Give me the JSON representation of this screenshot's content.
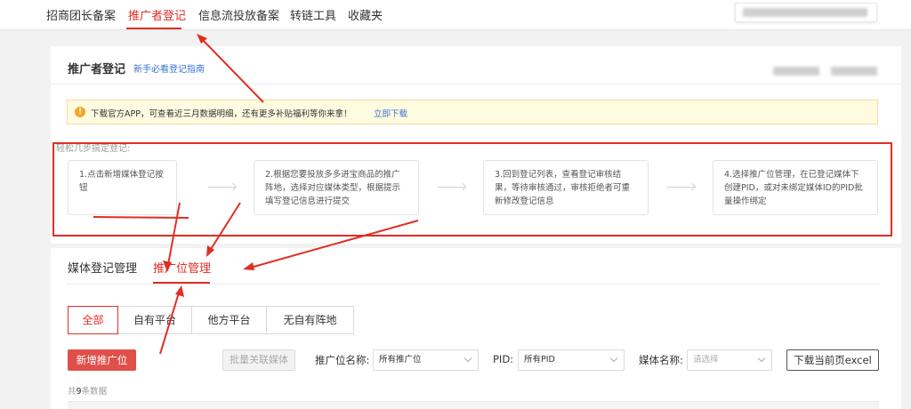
{
  "topnav": {
    "items": [
      "招商团长备案",
      "推广者登记",
      "信息流投放备案",
      "转链工具",
      "收藏夹"
    ],
    "active_index": 1
  },
  "register": {
    "title": "推广者登记",
    "guide_link": "新手必看登记指南",
    "notice": {
      "text": "下载官方APP，可查看近三月数据明细，还有更多补贴福利等你来拿！",
      "link": "立即下载"
    },
    "steps_label": "轻松几步搞定登记:",
    "steps": [
      "1.点击新增媒体登记按钮",
      "2.根据您要投放多多进宝商品的推广阵地，选择对应媒体类型，根据提示填写登记信息进行提交",
      "3.回到登记列表，查看登记审核结果，等待审核通过，审核拒绝者可重新修改登记信息",
      "4.选择推广位管理，在已登记媒体下创建PID，或对未绑定媒体ID的PID批量操作绑定"
    ]
  },
  "management": {
    "tabs": [
      "媒体登记管理",
      "推广位管理"
    ],
    "active_tab": 1,
    "segments": [
      "全部",
      "自有平台",
      "他方平台",
      "无自有阵地"
    ],
    "active_segment": 0,
    "toolbar": {
      "add_button": "新增推广位",
      "batch_button": "批量关联媒体",
      "position_label": "推广位名称:",
      "position_value": "所有推广位",
      "pid_label": "PID:",
      "pid_value": "所有PID",
      "media_label": "媒体名称:",
      "media_placeholder": "请选择",
      "export_button": "下载当前页excel"
    },
    "count_prefix": "共",
    "count_value": "9",
    "count_suffix": "条数据"
  },
  "colors": {
    "accent": "#e02e24",
    "link": "#3a73d1",
    "notice_bg": "#fffbe0"
  }
}
